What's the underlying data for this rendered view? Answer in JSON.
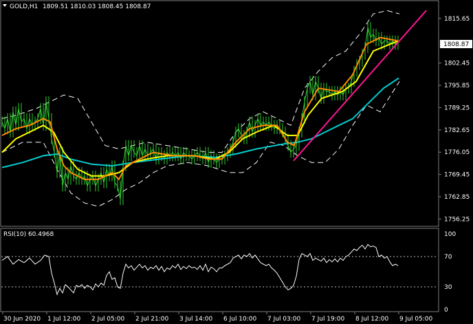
{
  "header": {
    "title": "GOLD,H1",
    "ohlc": "1809.51 1810.03 1808.45 1808.87"
  },
  "price_panel": {
    "current_price": "1808.87",
    "ylim": [
      1754.5,
      1820.5
    ],
    "ticks": [
      "1815.65",
      "1808.87",
      "1802.45",
      "1795.85",
      "1789.25",
      "1782.65",
      "1776.05",
      "1769.45",
      "1762.85",
      "1756.25"
    ]
  },
  "rsi_panel": {
    "label": "RSI(10) 60.4968",
    "ticks": [
      "100",
      "70",
      "30",
      "0"
    ],
    "levels": [
      70,
      30
    ]
  },
  "time_axis": {
    "labels": [
      "30 Jun 2020",
      "1 Jul 12:00",
      "2 Jul 05:00",
      "2 Jul 21:00",
      "3 Jul 14:00",
      "6 Jul 10:00",
      "7 Jul 03:00",
      "7 Jul 19:00",
      "8 Jul 12:00",
      "9 Jul 05:00"
    ]
  },
  "colors": {
    "price_line": "#32cd32",
    "ema_fast": "#ff8c00",
    "ema_slow": "#ffff00",
    "ma_long": "#00ced1",
    "bands": "#ffffff",
    "trendline": "#ff1493",
    "rsi_line": "#ffffff",
    "price_label_bg": "#ffffff"
  },
  "chart_data": {
    "type": "line",
    "price": [
      [
        0,
        1785
      ],
      [
        4,
        1783
      ],
      [
        8,
        1786
      ],
      [
        12,
        1782
      ],
      [
        16,
        1788
      ],
      [
        20,
        1784
      ],
      [
        24,
        1789
      ],
      [
        28,
        1785
      ],
      [
        32,
        1786
      ],
      [
        36,
        1783
      ],
      [
        40,
        1786
      ],
      [
        44,
        1784
      ],
      [
        48,
        1785
      ],
      [
        52,
        1786
      ],
      [
        56,
        1789
      ],
      [
        60,
        1784
      ],
      [
        64,
        1791
      ],
      [
        68,
        1786
      ],
      [
        72,
        1780
      ],
      [
        76,
        1776
      ],
      [
        80,
        1770
      ],
      [
        84,
        1776
      ],
      [
        88,
        1766
      ],
      [
        92,
        1770
      ],
      [
        96,
        1768
      ],
      [
        100,
        1772
      ],
      [
        104,
        1769
      ],
      [
        108,
        1768
      ],
      [
        112,
        1770
      ],
      [
        116,
        1768
      ],
      [
        120,
        1769
      ],
      [
        124,
        1766
      ],
      [
        128,
        1768
      ],
      [
        132,
        1769
      ],
      [
        136,
        1766
      ],
      [
        140,
        1768
      ],
      [
        144,
        1770
      ],
      [
        148,
        1767
      ],
      [
        152,
        1771
      ],
      [
        156,
        1769
      ],
      [
        160,
        1772
      ],
      [
        164,
        1767
      ],
      [
        168,
        1766
      ],
      [
        172,
        1762
      ],
      [
        176,
        1772
      ],
      [
        180,
        1778
      ],
      [
        184,
        1775
      ],
      [
        188,
        1778
      ],
      [
        192,
        1776
      ],
      [
        196,
        1775
      ],
      [
        200,
        1778
      ],
      [
        204,
        1775
      ],
      [
        208,
        1777
      ],
      [
        212,
        1775
      ],
      [
        216,
        1776
      ],
      [
        220,
        1777
      ],
      [
        224,
        1774
      ],
      [
        228,
        1776
      ],
      [
        232,
        1775
      ],
      [
        236,
        1774
      ],
      [
        240,
        1776
      ],
      [
        244,
        1775
      ],
      [
        248,
        1776
      ],
      [
        252,
        1775
      ],
      [
        256,
        1776
      ],
      [
        260,
        1774
      ],
      [
        264,
        1776
      ],
      [
        268,
        1775
      ],
      [
        272,
        1775
      ],
      [
        276,
        1774
      ],
      [
        280,
        1775
      ],
      [
        284,
        1776
      ],
      [
        288,
        1775
      ],
      [
        292,
        1774
      ],
      [
        296,
        1776
      ],
      [
        300,
        1773
      ],
      [
        304,
        1775
      ],
      [
        308,
        1774
      ],
      [
        312,
        1773
      ],
      [
        316,
        1774
      ],
      [
        320,
        1774
      ],
      [
        324,
        1775
      ],
      [
        328,
        1776
      ],
      [
        332,
        1777
      ],
      [
        336,
        1779
      ],
      [
        340,
        1782
      ],
      [
        344,
        1783
      ],
      [
        348,
        1781
      ],
      [
        352,
        1780
      ],
      [
        356,
        1782
      ],
      [
        360,
        1785
      ],
      [
        364,
        1782
      ],
      [
        368,
        1784
      ],
      [
        372,
        1786
      ],
      [
        376,
        1784
      ],
      [
        380,
        1785
      ],
      [
        384,
        1784
      ],
      [
        388,
        1785
      ],
      [
        392,
        1784
      ],
      [
        396,
        1783
      ],
      [
        400,
        1784
      ],
      [
        404,
        1783
      ],
      [
        408,
        1782
      ],
      [
        412,
        1780
      ],
      [
        416,
        1778
      ],
      [
        420,
        1776
      ],
      [
        424,
        1777
      ],
      [
        428,
        1778
      ],
      [
        432,
        1782
      ],
      [
        436,
        1786
      ],
      [
        440,
        1791
      ],
      [
        444,
        1795
      ],
      [
        448,
        1797
      ],
      [
        452,
        1793
      ],
      [
        456,
        1797
      ],
      [
        460,
        1795
      ],
      [
        464,
        1792
      ],
      [
        468,
        1795
      ],
      [
        472,
        1794
      ],
      [
        476,
        1794
      ],
      [
        480,
        1793
      ],
      [
        484,
        1794
      ],
      [
        488,
        1793
      ],
      [
        492,
        1794
      ],
      [
        496,
        1793
      ],
      [
        500,
        1795
      ],
      [
        504,
        1795
      ],
      [
        508,
        1797
      ],
      [
        512,
        1800
      ],
      [
        516,
        1802
      ],
      [
        520,
        1803
      ],
      [
        524,
        1805
      ],
      [
        528,
        1807
      ],
      [
        532,
        1813
      ],
      [
        536,
        1810
      ],
      [
        540,
        1811
      ],
      [
        544,
        1809
      ],
      [
        548,
        1810
      ],
      [
        552,
        1808
      ],
      [
        556,
        1809
      ],
      [
        560,
        1809
      ],
      [
        564,
        1808
      ],
      [
        568,
        1809
      ],
      [
        572,
        1808
      ],
      [
        576,
        1809
      ]
    ],
    "ema_fast": [
      [
        0,
        1781
      ],
      [
        20,
        1783
      ],
      [
        40,
        1784
      ],
      [
        60,
        1786
      ],
      [
        70,
        1785
      ],
      [
        80,
        1777
      ],
      [
        90,
        1772
      ],
      [
        100,
        1770
      ],
      [
        120,
        1768
      ],
      [
        140,
        1768
      ],
      [
        160,
        1770
      ],
      [
        170,
        1768
      ],
      [
        180,
        1772
      ],
      [
        200,
        1774
      ],
      [
        220,
        1776
      ],
      [
        250,
        1775
      ],
      [
        280,
        1775
      ],
      [
        300,
        1774
      ],
      [
        320,
        1774
      ],
      [
        340,
        1779
      ],
      [
        360,
        1783
      ],
      [
        380,
        1784
      ],
      [
        400,
        1784
      ],
      [
        415,
        1779
      ],
      [
        425,
        1778
      ],
      [
        440,
        1788
      ],
      [
        460,
        1795
      ],
      [
        490,
        1794
      ],
      [
        510,
        1799
      ],
      [
        530,
        1808
      ],
      [
        550,
        1810
      ],
      [
        576,
        1809
      ]
    ],
    "ema_slow": [
      [
        0,
        1776
      ],
      [
        20,
        1780
      ],
      [
        40,
        1782
      ],
      [
        60,
        1784
      ],
      [
        75,
        1782
      ],
      [
        90,
        1776
      ],
      [
        110,
        1771
      ],
      [
        130,
        1769
      ],
      [
        150,
        1769
      ],
      [
        170,
        1770
      ],
      [
        190,
        1773
      ],
      [
        210,
        1774
      ],
      [
        240,
        1775
      ],
      [
        280,
        1775
      ],
      [
        310,
        1774
      ],
      [
        330,
        1776
      ],
      [
        350,
        1780
      ],
      [
        370,
        1782
      ],
      [
        395,
        1784
      ],
      [
        415,
        1781
      ],
      [
        430,
        1781
      ],
      [
        445,
        1787
      ],
      [
        465,
        1792
      ],
      [
        495,
        1794
      ],
      [
        515,
        1797
      ],
      [
        540,
        1806
      ],
      [
        576,
        1809
      ]
    ],
    "ma_long": [
      [
        0,
        1771.5
      ],
      [
        30,
        1773
      ],
      [
        60,
        1775
      ],
      [
        80,
        1775.5
      ],
      [
        100,
        1774
      ],
      [
        130,
        1772.5
      ],
      [
        160,
        1772
      ],
      [
        190,
        1773
      ],
      [
        230,
        1774
      ],
      [
        270,
        1775
      ],
      [
        310,
        1774.5
      ],
      [
        340,
        1775.5
      ],
      [
        370,
        1777
      ],
      [
        410,
        1778.5
      ],
      [
        430,
        1779
      ],
      [
        450,
        1780
      ],
      [
        470,
        1782
      ],
      [
        490,
        1784
      ],
      [
        510,
        1786
      ],
      [
        530,
        1790
      ],
      [
        555,
        1795
      ],
      [
        577,
        1798
      ]
    ],
    "band_upper": [
      [
        0,
        1786
      ],
      [
        20,
        1787
      ],
      [
        50,
        1789
      ],
      [
        70,
        1791
      ],
      [
        90,
        1793
      ],
      [
        110,
        1792
      ],
      [
        130,
        1785
      ],
      [
        150,
        1778
      ],
      [
        170,
        1777
      ],
      [
        190,
        1778
      ],
      [
        210,
        1779
      ],
      [
        240,
        1778
      ],
      [
        270,
        1777
      ],
      [
        300,
        1776
      ],
      [
        320,
        1776
      ],
      [
        340,
        1782
      ],
      [
        360,
        1786
      ],
      [
        380,
        1788
      ],
      [
        400,
        1786
      ],
      [
        420,
        1784
      ],
      [
        440,
        1795
      ],
      [
        460,
        1800
      ],
      [
        480,
        1804
      ],
      [
        500,
        1806
      ],
      [
        520,
        1811
      ],
      [
        540,
        1817
      ],
      [
        560,
        1818
      ],
      [
        578,
        1817
      ]
    ],
    "band_lower": [
      [
        0,
        1776
      ],
      [
        30,
        1779
      ],
      [
        60,
        1779
      ],
      [
        80,
        1771
      ],
      [
        100,
        1764
      ],
      [
        120,
        1761
      ],
      [
        140,
        1760
      ],
      [
        160,
        1762
      ],
      [
        180,
        1765
      ],
      [
        200,
        1767
      ],
      [
        220,
        1770
      ],
      [
        240,
        1772
      ],
      [
        270,
        1773
      ],
      [
        300,
        1772
      ],
      [
        330,
        1770
      ],
      [
        350,
        1770
      ],
      [
        370,
        1773
      ],
      [
        390,
        1779
      ],
      [
        410,
        1778
      ],
      [
        430,
        1775
      ],
      [
        450,
        1773
      ],
      [
        470,
        1773
      ],
      [
        490,
        1777
      ],
      [
        510,
        1784
      ],
      [
        530,
        1790
      ],
      [
        550,
        1788
      ],
      [
        578,
        1797
      ]
    ],
    "trendline": [
      [
        424,
        1773.5
      ],
      [
        617,
        1818
      ]
    ],
    "rsi": [
      [
        0,
        65
      ],
      [
        8,
        70
      ],
      [
        16,
        60
      ],
      [
        24,
        66
      ],
      [
        32,
        62
      ],
      [
        40,
        68
      ],
      [
        48,
        60
      ],
      [
        56,
        65
      ],
      [
        62,
        72
      ],
      [
        68,
        70
      ],
      [
        72,
        48
      ],
      [
        76,
        35
      ],
      [
        80,
        20
      ],
      [
        84,
        28
      ],
      [
        88,
        22
      ],
      [
        92,
        33
      ],
      [
        96,
        30
      ],
      [
        100,
        26
      ],
      [
        104,
        22
      ],
      [
        108,
        32
      ],
      [
        112,
        30
      ],
      [
        116,
        33
      ],
      [
        120,
        28
      ],
      [
        124,
        32
      ],
      [
        128,
        30
      ],
      [
        132,
        26
      ],
      [
        136,
        34
      ],
      [
        140,
        30
      ],
      [
        144,
        35
      ],
      [
        148,
        32
      ],
      [
        152,
        45
      ],
      [
        156,
        50
      ],
      [
        160,
        40
      ],
      [
        164,
        42
      ],
      [
        168,
        30
      ],
      [
        172,
        28
      ],
      [
        176,
        48
      ],
      [
        180,
        60
      ],
      [
        184,
        55
      ],
      [
        188,
        58
      ],
      [
        192,
        52
      ],
      [
        196,
        56
      ],
      [
        200,
        60
      ],
      [
        204,
        55
      ],
      [
        208,
        58
      ],
      [
        212,
        52
      ],
      [
        216,
        56
      ],
      [
        220,
        54
      ],
      [
        224,
        58
      ],
      [
        228,
        52
      ],
      [
        232,
        57
      ],
      [
        236,
        50
      ],
      [
        240,
        55
      ],
      [
        244,
        53
      ],
      [
        248,
        58
      ],
      [
        252,
        55
      ],
      [
        256,
        60
      ],
      [
        260,
        53
      ],
      [
        264,
        57
      ],
      [
        268,
        54
      ],
      [
        272,
        58
      ],
      [
        276,
        55
      ],
      [
        280,
        56
      ],
      [
        284,
        53
      ],
      [
        288,
        58
      ],
      [
        292,
        52
      ],
      [
        296,
        60
      ],
      [
        300,
        50
      ],
      [
        304,
        56
      ],
      [
        308,
        54
      ],
      [
        312,
        50
      ],
      [
        316,
        55
      ],
      [
        320,
        55
      ],
      [
        324,
        58
      ],
      [
        328,
        60
      ],
      [
        332,
        62
      ],
      [
        336,
        68
      ],
      [
        340,
        70
      ],
      [
        344,
        72
      ],
      [
        348,
        67
      ],
      [
        352,
        72
      ],
      [
        356,
        70
      ],
      [
        360,
        74
      ],
      [
        364,
        68
      ],
      [
        368,
        72
      ],
      [
        372,
        67
      ],
      [
        376,
        62
      ],
      [
        380,
        60
      ],
      [
        384,
        58
      ],
      [
        388,
        60
      ],
      [
        392,
        55
      ],
      [
        396,
        52
      ],
      [
        400,
        48
      ],
      [
        404,
        42
      ],
      [
        408,
        36
      ],
      [
        412,
        30
      ],
      [
        416,
        26
      ],
      [
        420,
        28
      ],
      [
        424,
        32
      ],
      [
        428,
        44
      ],
      [
        432,
        66
      ],
      [
        436,
        74
      ],
      [
        440,
        72
      ],
      [
        444,
        70
      ],
      [
        448,
        74
      ],
      [
        452,
        65
      ],
      [
        456,
        68
      ],
      [
        460,
        66
      ],
      [
        464,
        64
      ],
      [
        468,
        68
      ],
      [
        472,
        62
      ],
      [
        476,
        66
      ],
      [
        480,
        63
      ],
      [
        484,
        67
      ],
      [
        488,
        63
      ],
      [
        492,
        68
      ],
      [
        496,
        65
      ],
      [
        500,
        70
      ],
      [
        504,
        72
      ],
      [
        508,
        76
      ],
      [
        512,
        80
      ],
      [
        516,
        78
      ],
      [
        520,
        82
      ],
      [
        524,
        85
      ],
      [
        528,
        80
      ],
      [
        532,
        86
      ],
      [
        536,
        83
      ],
      [
        540,
        84
      ],
      [
        544,
        82
      ],
      [
        548,
        70
      ],
      [
        552,
        72
      ],
      [
        556,
        68
      ],
      [
        560,
        70
      ],
      [
        564,
        63
      ],
      [
        568,
        58
      ],
      [
        572,
        60
      ],
      [
        576,
        58
      ]
    ]
  }
}
